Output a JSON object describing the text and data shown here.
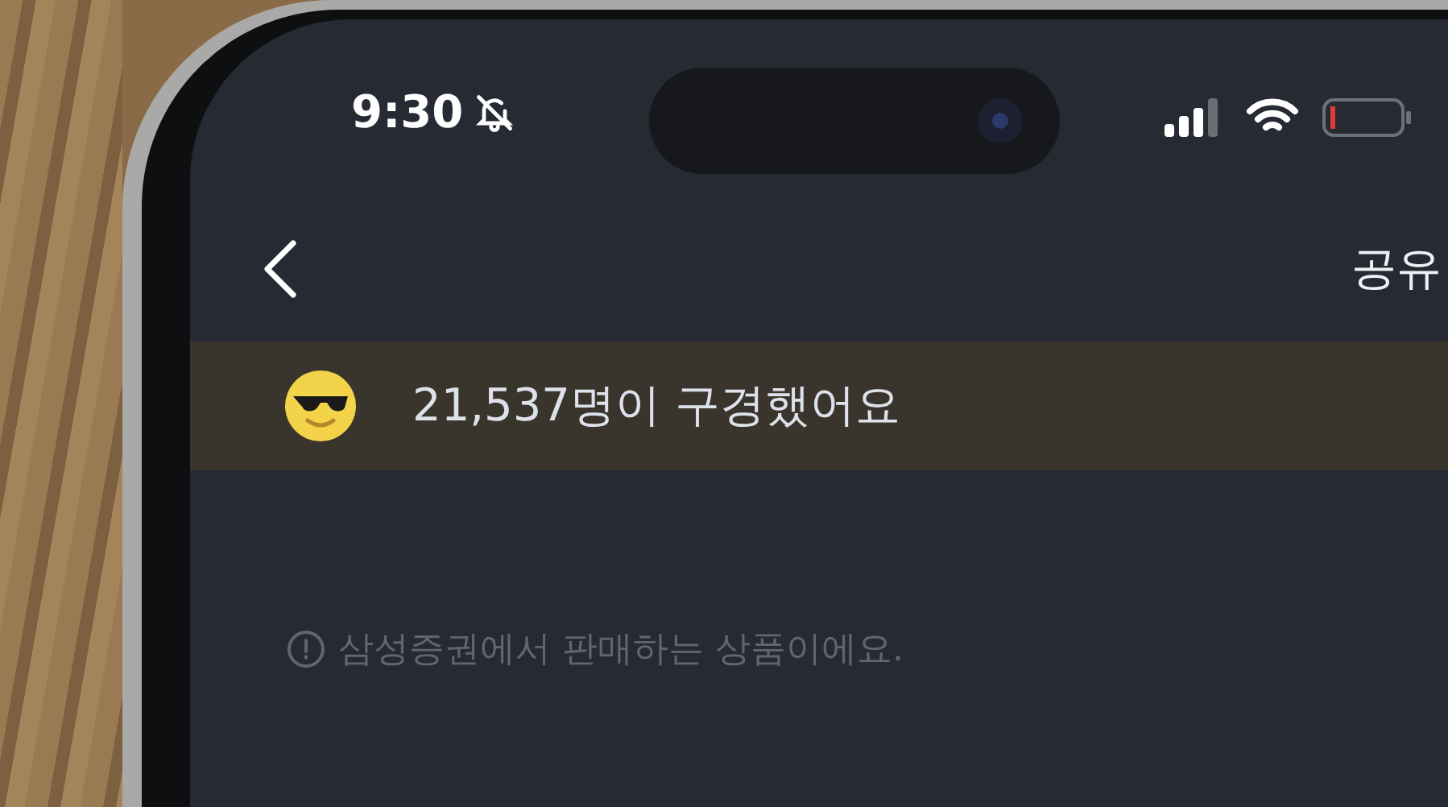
{
  "status_bar": {
    "time": "9:30",
    "silent": true
  },
  "nav": {
    "action": "공유"
  },
  "views_banner": {
    "text": "21,537명이 구경했어요"
  },
  "notice": {
    "text": "삼성증권에서 판매하는 상품이에요."
  }
}
